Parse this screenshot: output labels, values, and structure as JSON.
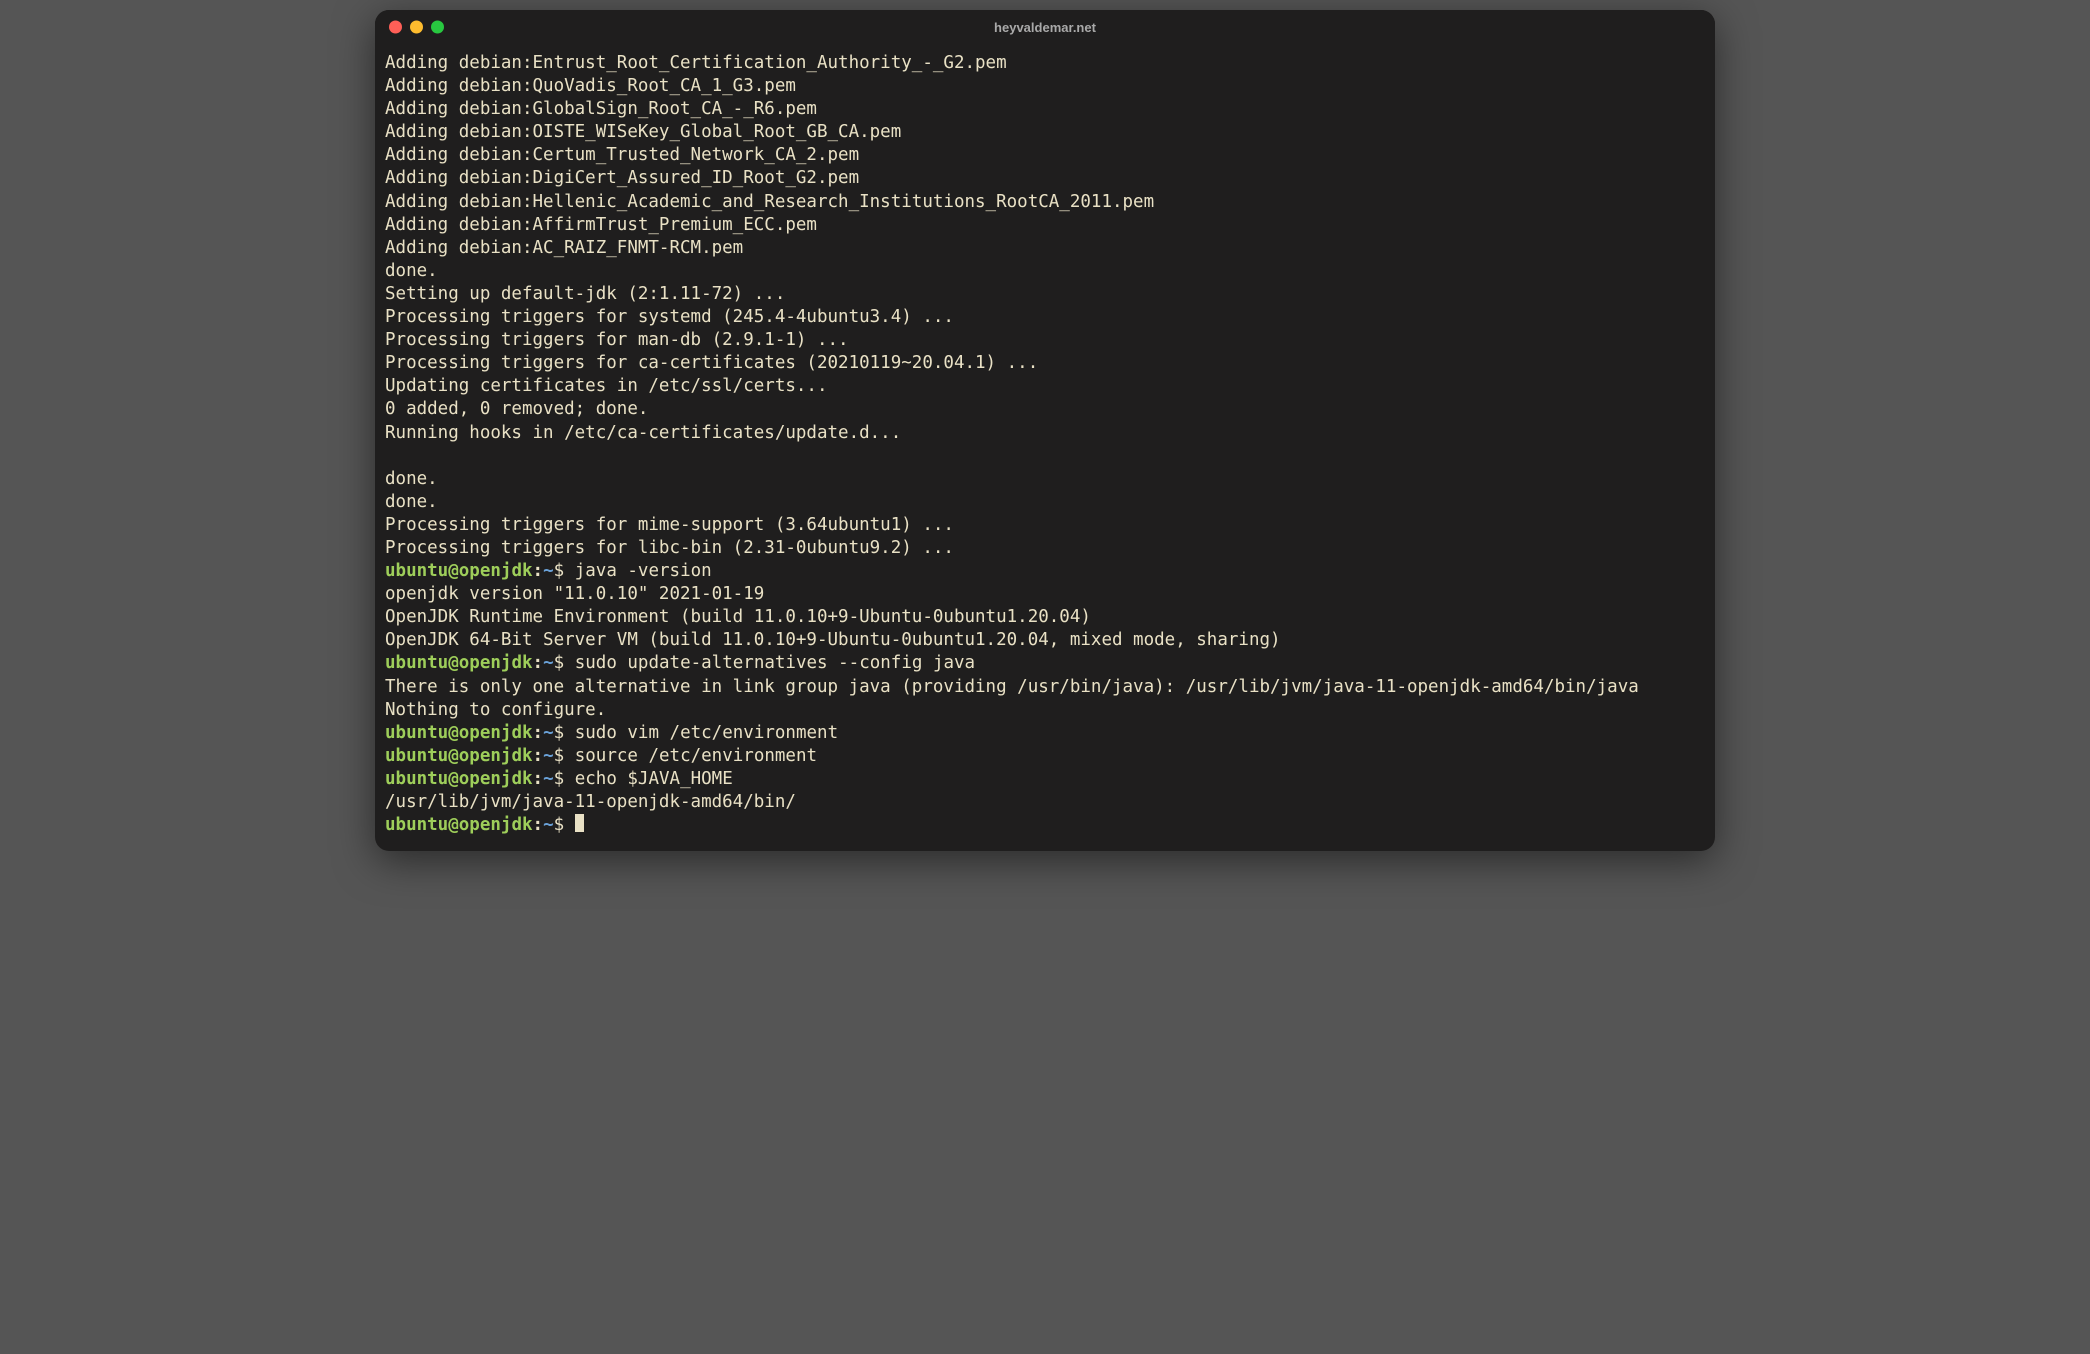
{
  "window": {
    "title": "heyvaldemar.net"
  },
  "prompt": {
    "user": "ubuntu",
    "host": "openjdk",
    "path": "~",
    "sigil": "$"
  },
  "out": {
    "add0": "Adding debian:Entrust_Root_Certification_Authority_-_G2.pem",
    "add1": "Adding debian:QuoVadis_Root_CA_1_G3.pem",
    "add2": "Adding debian:GlobalSign_Root_CA_-_R6.pem",
    "add3": "Adding debian:OISTE_WISeKey_Global_Root_GB_CA.pem",
    "add4": "Adding debian:Certum_Trusted_Network_CA_2.pem",
    "add5": "Adding debian:DigiCert_Assured_ID_Root_G2.pem",
    "add6": "Adding debian:Hellenic_Academic_and_Research_Institutions_RootCA_2011.pem",
    "add7": "Adding debian:AffirmTrust_Premium_ECC.pem",
    "add8": "Adding debian:AC_RAIZ_FNMT-RCM.pem",
    "done1": "done.",
    "setup1": "Setting up default-jdk (2:1.11-72) ...",
    "trig1": "Processing triggers for systemd (245.4-4ubuntu3.4) ...",
    "trig2": "Processing triggers for man-db (2.9.1-1) ...",
    "trig3": "Processing triggers for ca-certificates (20210119~20.04.1) ...",
    "updcert": "Updating certificates in /etc/ssl/certs...",
    "zeroadded": "0 added, 0 removed; done.",
    "hooks": "Running hooks in /etc/ca-certificates/update.d...",
    "blank": "",
    "done2": "done.",
    "done3": "done.",
    "trig4": "Processing triggers for mime-support (3.64ubuntu1) ...",
    "trig5": "Processing triggers for libc-bin (2.31-0ubuntu9.2) ...",
    "cmd1": "java -version",
    "jv1": "openjdk version \"11.0.10\" 2021-01-19",
    "jv2": "OpenJDK Runtime Environment (build 11.0.10+9-Ubuntu-0ubuntu1.20.04)",
    "jv3": "OpenJDK 64-Bit Server VM (build 11.0.10+9-Ubuntu-0ubuntu1.20.04, mixed mode, sharing)",
    "cmd2": "sudo update-alternatives --config java",
    "ua1": "There is only one alternative in link group java (providing /usr/bin/java): /usr/lib/jvm/java-11-openjdk-amd64/bin/java",
    "ua2": "Nothing to configure.",
    "cmd3": "sudo vim /etc/environment",
    "cmd4": "source /etc/environment",
    "cmd5": "echo $JAVA_HOME",
    "jh": "/usr/lib/jvm/java-11-openjdk-amd64/bin/"
  }
}
